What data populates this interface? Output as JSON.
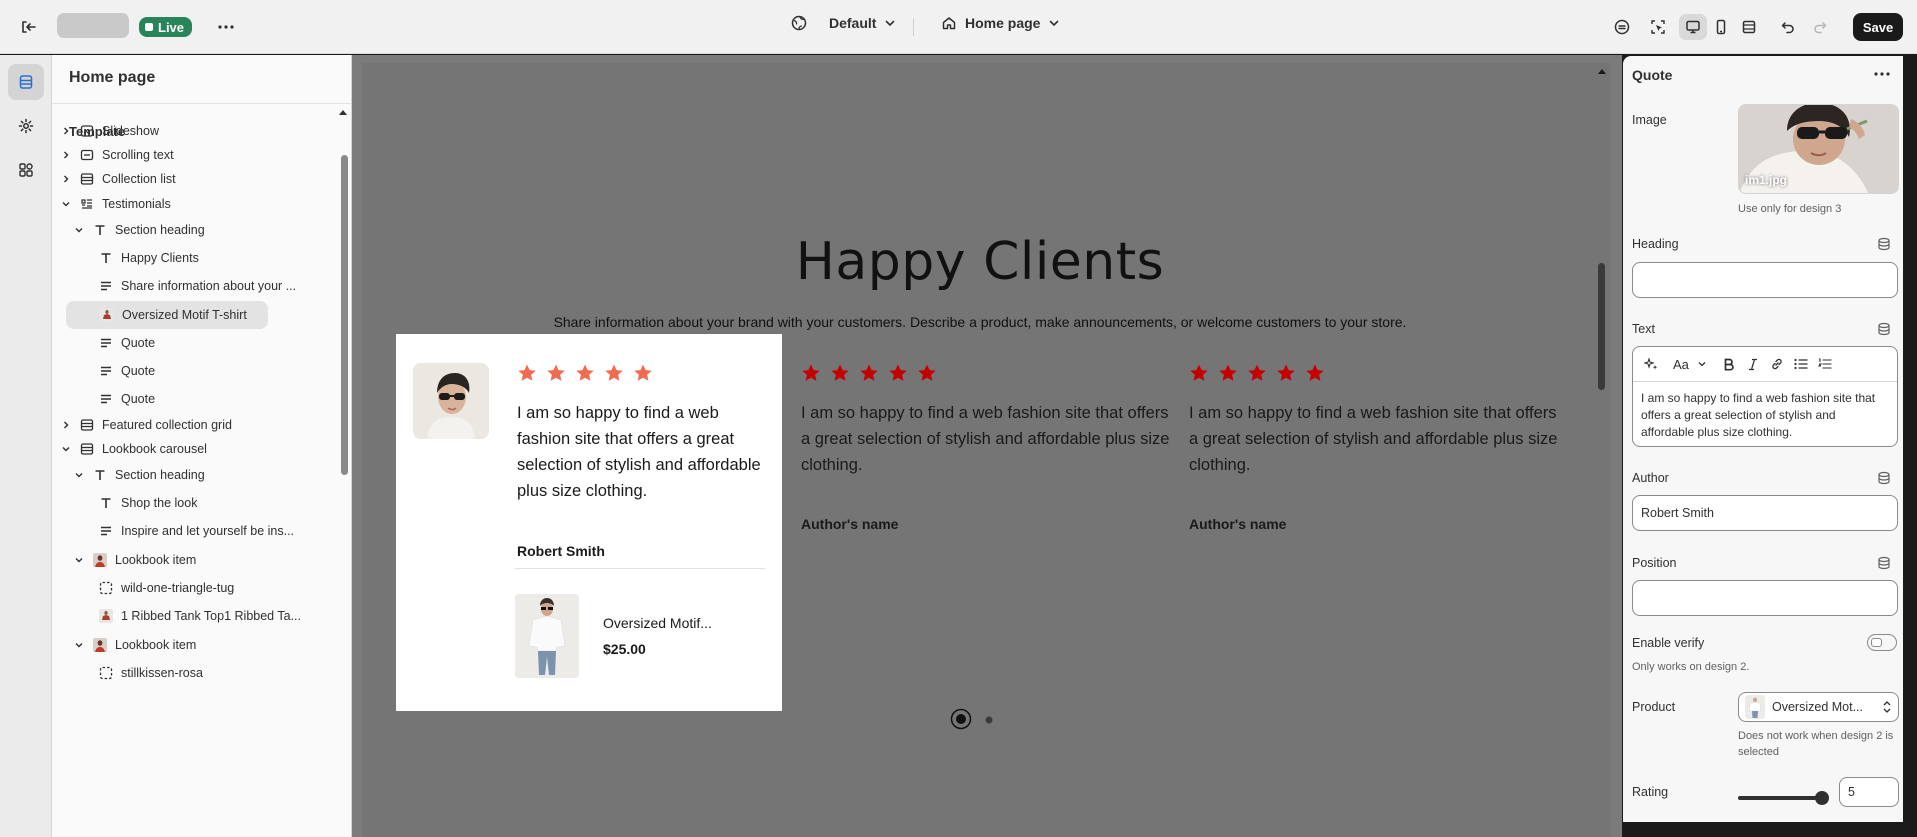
{
  "topbar": {
    "live_badge": "Live",
    "theme_selector": "Default",
    "page_selector": "Home page",
    "save_label": "Save"
  },
  "left_panel": {
    "title": "Home page",
    "template_heading": "Template",
    "tree": [
      {
        "label": "Slideshow",
        "icon": "slideshow-icon"
      },
      {
        "label": "Scrolling text",
        "icon": "scrolling-text-icon"
      },
      {
        "label": "Collection list",
        "icon": "collection-list-icon"
      },
      {
        "label": "Testimonials",
        "icon": "testimonials-icon"
      },
      {
        "label": "Section heading",
        "icon": "text-icon"
      },
      {
        "label": "Happy Clients",
        "icon": "text-icon"
      },
      {
        "label": "Share information about your ...",
        "icon": "paragraph-icon"
      },
      {
        "label": "Oversized Motif T-shirt",
        "icon": "product-thumbnail-icon"
      },
      {
        "label": "Quote",
        "icon": "paragraph-icon"
      },
      {
        "label": "Quote",
        "icon": "paragraph-icon"
      },
      {
        "label": "Quote",
        "icon": "paragraph-icon"
      },
      {
        "label": "Featured collection grid",
        "icon": "collection-grid-icon"
      },
      {
        "label": "Lookbook carousel",
        "icon": "carousel-icon"
      },
      {
        "label": "Section heading",
        "icon": "text-icon"
      },
      {
        "label": "Shop the look",
        "icon": "text-icon"
      },
      {
        "label": "Inspire and let yourself be ins...",
        "icon": "paragraph-icon"
      },
      {
        "label": "Lookbook item",
        "icon": "image-thumbnail-icon"
      },
      {
        "label": "wild-one-triangle-tug",
        "icon": "dashed-square-icon"
      },
      {
        "label": "1 Ribbed Tank Top1 Ribbed Ta...",
        "icon": "product-thumbnail-icon"
      },
      {
        "label": "Lookbook item",
        "icon": "image-thumbnail-icon"
      },
      {
        "label": "stillkissen-rosa",
        "icon": "dashed-square-icon"
      }
    ]
  },
  "preview": {
    "heading": "Happy Clients",
    "subheading": "Share information about your brand with your customers. Describe a product, make announcements, or welcome customers to your store.",
    "rating_stars": 5,
    "quotes": [
      {
        "text": "I am so happy to find a web fashion site that offers a great selection of stylish and affordable plus size clothing.",
        "author": "Robert Smith",
        "product_name": "Oversized Motif...",
        "product_price": "$25.00"
      },
      {
        "text": "I am so happy to find a web fashion site that offers a great selection of stylish and affordable plus size clothing.",
        "author": "Author's name"
      },
      {
        "text": "I am so happy to find a web fashion site that offers a great selection of stylish and affordable plus size clothing.",
        "author": "Author's name"
      }
    ],
    "active_slide": 1,
    "slide_count": 2,
    "colors": {
      "highlighted_star": "#f26b4f",
      "star": "#c40000"
    }
  },
  "settings": {
    "title": "Quote",
    "image_label": "Image",
    "image_filename": "im1.jpg",
    "image_help": "Use only for design 3",
    "heading_label": "Heading",
    "heading_value": "",
    "text_label": "Text",
    "text_value": "I am so happy to find a web fashion site that offers a great selection of stylish and affordable plus size clothing.",
    "toolbar_font": "Aa",
    "author_label": "Author",
    "author_value": "Robert Smith",
    "position_label": "Position",
    "position_value": "",
    "enable_verify_label": "Enable verify",
    "enable_verify_on": false,
    "enable_verify_help": "Only works on design 2.",
    "product_label": "Product",
    "product_value": "Oversized Mot...",
    "product_help": "Does not work when design 2 is selected",
    "rating_label": "Rating",
    "rating_value": "5"
  }
}
